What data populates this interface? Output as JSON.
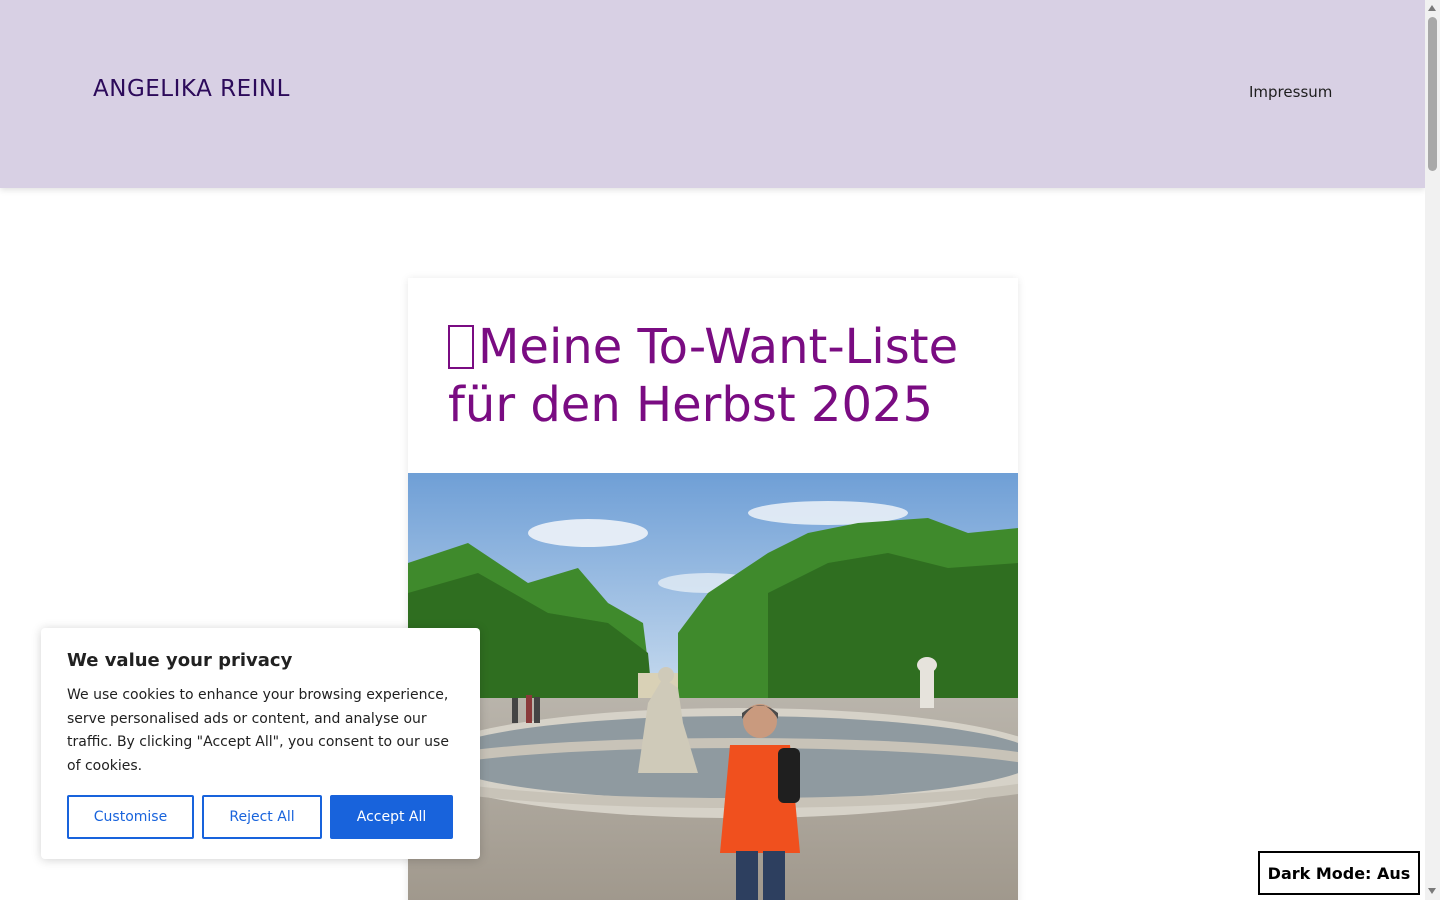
{
  "header": {
    "site_title": "ANGELIKA REINL",
    "nav_items": [
      {
        "label": "Impressum"
      }
    ],
    "background_color": "#d8d0e4"
  },
  "article": {
    "title": "Meine To-Want-Liste für den Herbst 2025",
    "title_color": "#7a0c82",
    "title_leading_glyph": "unknown-glyph-icon"
  },
  "cookie_banner": {
    "title": "We value your privacy",
    "text": "We use cookies to enhance your browsing experience, serve personalised ads or content, and analyse our traffic. By clicking \"Accept All\", you consent to our use of cookies.",
    "buttons": {
      "customise": "Customise",
      "reject": "Reject All",
      "accept": "Accept All"
    },
    "accent_color": "#1863dc"
  },
  "dark_mode_toggle": {
    "label": "Dark Mode: Aus"
  }
}
